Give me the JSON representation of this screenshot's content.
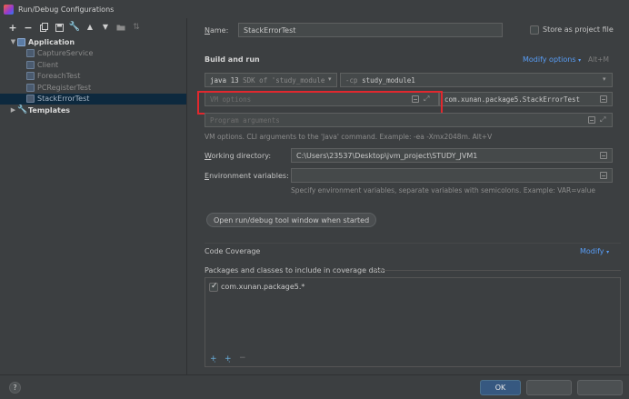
{
  "window": {
    "title": "Run/Debug Configurations"
  },
  "toolbar": {
    "icons": [
      "plus-icon",
      "minus-icon",
      "copy-icon",
      "save-icon",
      "wrench-icon",
      "arrow-up-icon",
      "arrow-down-icon",
      "folder-icon",
      "sort-icon"
    ]
  },
  "tree": {
    "application": "Application",
    "items": [
      "CaptureService",
      "Client",
      "ForeachTest",
      "PCRegisterTest",
      "StackErrorTest"
    ],
    "selected": "StackErrorTest",
    "templates": "Templates"
  },
  "form": {
    "name_label": "Name:",
    "name_value": "StackErrorTest",
    "store_label": "Store as project file",
    "build_run_title": "Build and run",
    "modify_options": "Modify options",
    "modify_shortcut": "Alt+M",
    "jdk_value_prefix": "java 13",
    "jdk_value_suffix": "SDK of 'study_module",
    "cp_flag": "-cp",
    "cp_value": "study_module1",
    "vm_placeholder": "VM options",
    "main_class": "com.xunan.package5.StackErrorTest",
    "program_args_placeholder": "Program arguments",
    "vm_hint": "VM options. CLI arguments to the 'Java' command. Example: -ea -Xmx2048m. Alt+V",
    "workdir_label": "Working directory:",
    "workdir_value": "C:\\Users\\23537\\Desktop\\jvm_project\\STUDY_JVM1",
    "env_label": "Environment variables:",
    "env_hint": "Specify environment variables, separate variables with semicolons. Example: VAR=value",
    "open_tool_window": "Open run/debug tool window when started",
    "coverage_title": "Code Coverage",
    "coverage_modify": "Modify",
    "coverage_packages_label": "Packages and classes to include in coverage data",
    "coverage_item": "com.xunan.package5.*"
  },
  "buttons": {
    "help": "?",
    "ok": "OK",
    "cancel": "",
    "apply": ""
  },
  "colors": {
    "accent": "#589df6",
    "highlight": "#e0282e",
    "selection": "#0d293e"
  }
}
